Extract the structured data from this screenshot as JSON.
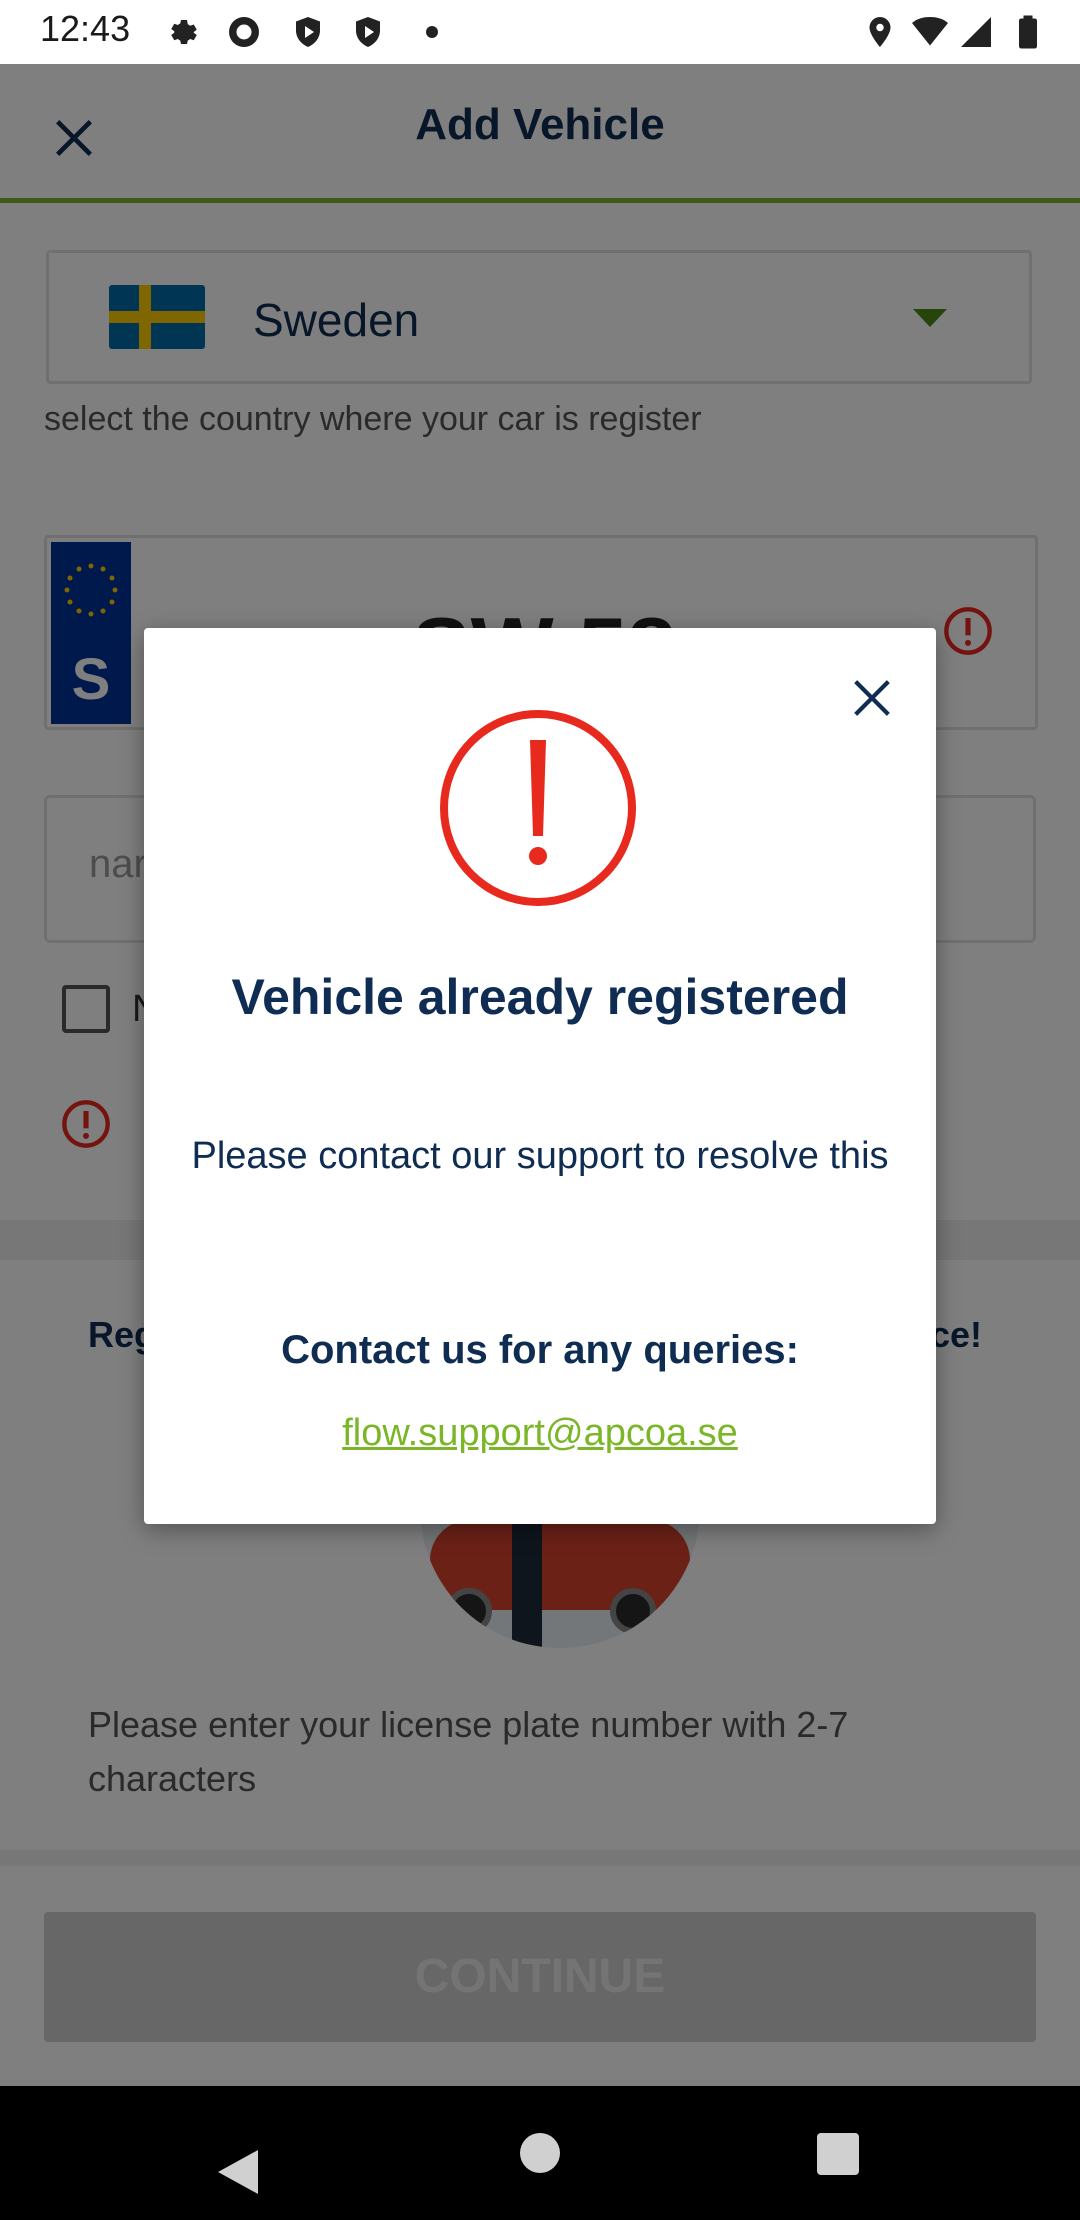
{
  "status_bar": {
    "time": "12:43",
    "left_icons": [
      "settings-icon",
      "sync-icon",
      "shield-icon",
      "shield-icon",
      "dot-icon"
    ],
    "right_icons": [
      "location-icon",
      "wifi-icon",
      "signal-icon",
      "battery-icon"
    ]
  },
  "app_bar": {
    "title": "Add Vehicle",
    "close_icon": "close-icon",
    "accent_color": "#7ab628"
  },
  "country_selector": {
    "country": "Sweden",
    "flag_icon": "sweden-flag-icon",
    "hint": "select the country where your car is register"
  },
  "plate_input": {
    "country_code": "S",
    "value": "SW 58",
    "error_icon": "error-icon"
  },
  "name_input": {
    "placeholder": "nar"
  },
  "checkbox": {
    "label": "N",
    "checked": false
  },
  "promo": {
    "left_text": "Reg",
    "right_text": "ce!"
  },
  "plate_rule": "Please enter your license plate number with 2-7 characters",
  "continue_label": "CONTINUE",
  "dialog": {
    "title": "Vehicle already registered",
    "message": "Please contact our support to resolve this",
    "contact_heading": "Contact us for any queries:",
    "email": "flow.support@apcoa.se",
    "alert_color": "#e8291d"
  }
}
